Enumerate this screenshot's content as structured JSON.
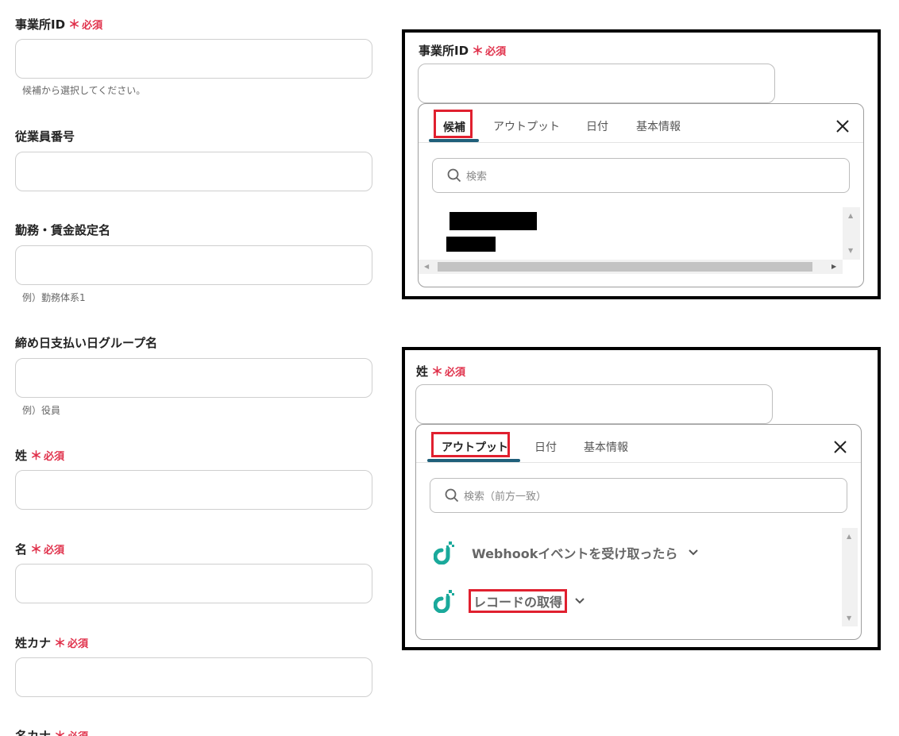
{
  "form": {
    "office_id": {
      "label": "事業所ID",
      "required": "必須",
      "hint": "候補から選択してください。"
    },
    "employee_number": {
      "label": "従業員番号"
    },
    "work_wage_setting": {
      "label": "勤務・賃金設定名",
      "hint": "例）勤務体系1"
    },
    "closing_group": {
      "label": "締め日支払い日グループ名",
      "hint": "例）役員"
    },
    "last_name": {
      "label": "姓",
      "required": "必須"
    },
    "first_name": {
      "label": "名",
      "required": "必須"
    },
    "last_name_kana": {
      "label": "姓カナ",
      "required": "必須"
    },
    "first_name_kana": {
      "label": "名カナ",
      "required": "必須"
    }
  },
  "required_mark": "＊",
  "panel1": {
    "label": "事業所ID",
    "required": "必須",
    "tabs": [
      "候補",
      "アウトプット",
      "日付",
      "基本情報"
    ],
    "active_tab": "候補",
    "search_placeholder": "検索"
  },
  "panel2": {
    "label": "姓",
    "required": "必須",
    "tabs": [
      "アウトプット",
      "日付",
      "基本情報"
    ],
    "active_tab": "アウトプット",
    "search_placeholder": "検索（前方一致）",
    "items": [
      {
        "label": "Webhookイベントを受け取ったら",
        "icon": "app-logo-icon"
      },
      {
        "label": "レコードの取得",
        "icon": "app-logo-icon"
      }
    ]
  },
  "colors": {
    "required": "#e0314b",
    "highlight": "#e0202f",
    "tab_underline": "#1f5f7a",
    "logo": "#1aa99b"
  }
}
